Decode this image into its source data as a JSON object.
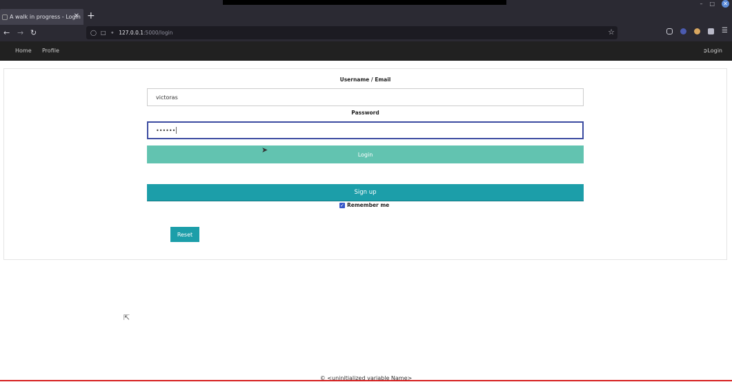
{
  "browser": {
    "tab_title": "A walk in progress - Login",
    "tab_close": "✕",
    "new_tab": "+",
    "url_host": "127.0.0.1",
    "url_rest": ":5000/login",
    "win_min": "–",
    "win_max": "□",
    "win_close": "✕"
  },
  "nav": {
    "home": "Home",
    "profile": "Profile",
    "login": "Login"
  },
  "form": {
    "username_label": "Username / Email",
    "username_value": "victoras",
    "password_label": "Password",
    "password_value": "••••••",
    "login_button": "Login",
    "signup_button": "Sign up",
    "remember_label": "Remember me",
    "remember_checked": true,
    "reset_button": "Reset"
  },
  "footer": {
    "text": "© <uninitialized variable Name>"
  },
  "colors": {
    "login_button": "#62c3b0",
    "signup_button": "#1c9ea9",
    "reset_button": "#1c9ea9",
    "navbar": "#212121"
  }
}
